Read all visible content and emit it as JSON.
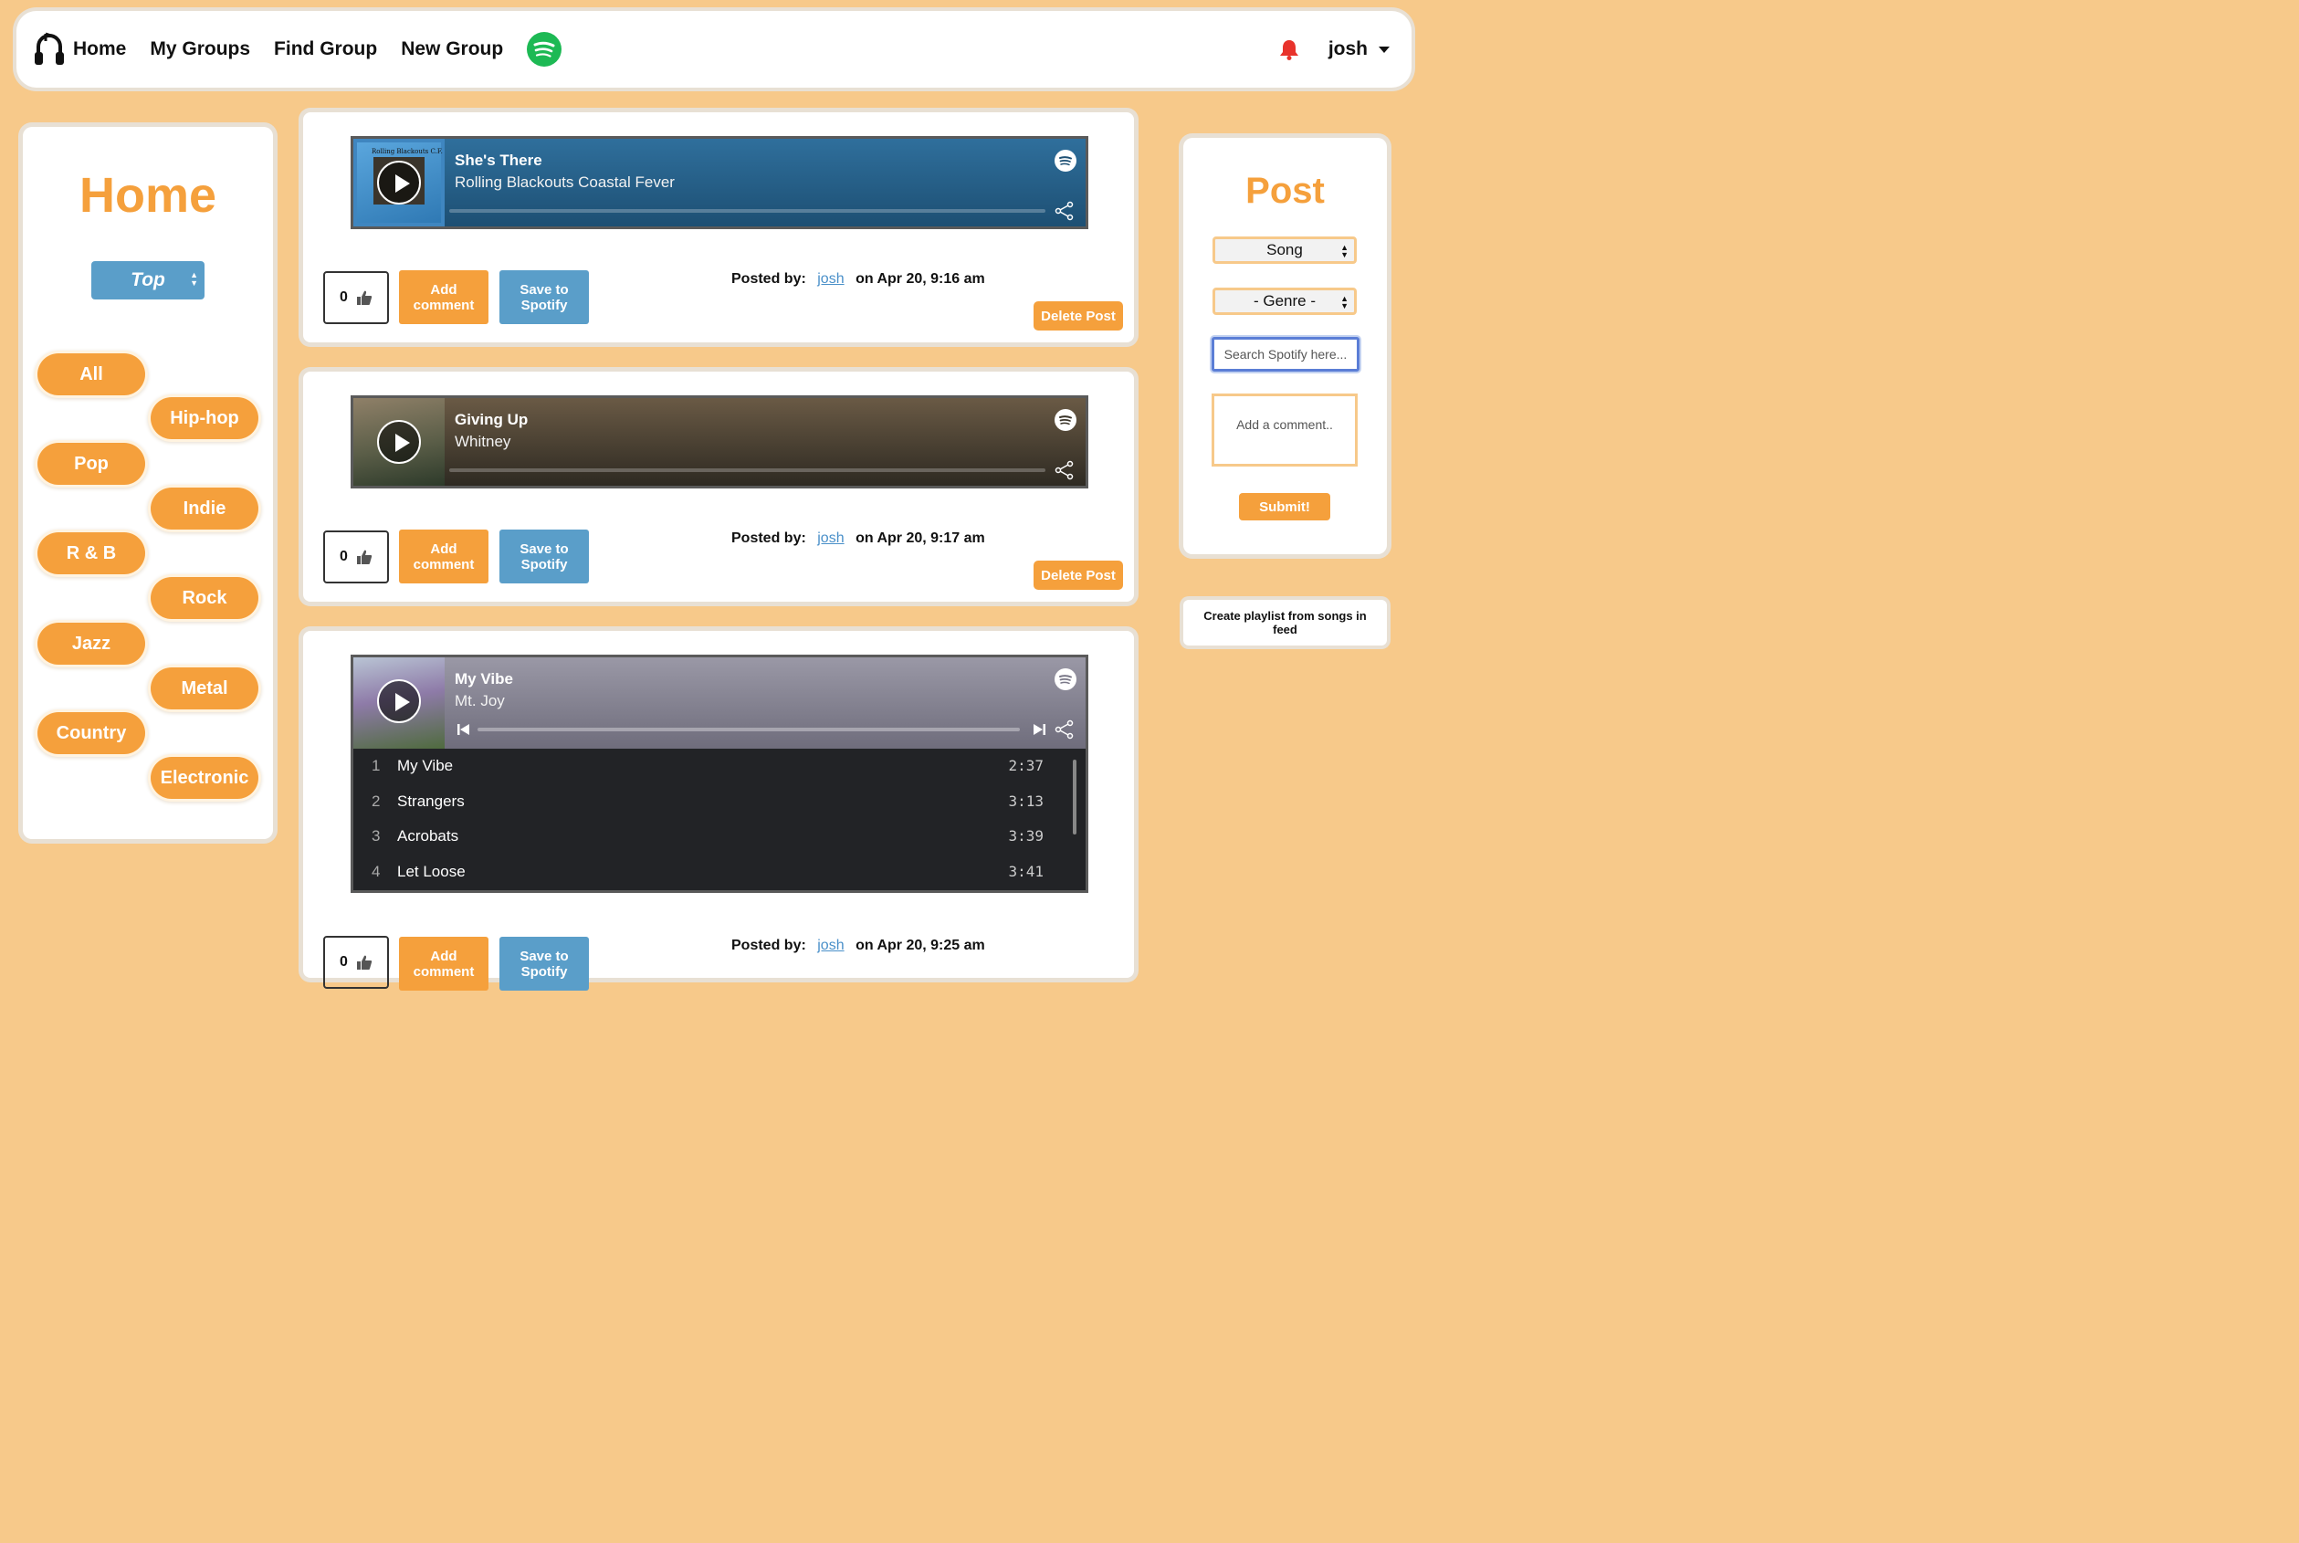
{
  "nav": {
    "home": "Home",
    "my_groups": "My Groups",
    "find_group": "Find Group",
    "new_group": "New Group",
    "user": "josh",
    "icons": [
      "headphones-logo-icon",
      "spotify-icon",
      "bell-icon",
      "caret-down-icon"
    ]
  },
  "left": {
    "title": "Home",
    "sort": "Top",
    "genres": [
      "All",
      "Hip-hop",
      "Pop",
      "Indie",
      "R & B",
      "Rock",
      "Jazz",
      "Metal",
      "Country",
      "Electronic"
    ]
  },
  "posts": [
    {
      "track": "She's There",
      "artist": "Rolling Blackouts Coastal Fever",
      "likes": "0",
      "add_comment": "Add comment",
      "save": "Save to Spotify",
      "posted_label": "Posted by:",
      "user": "josh",
      "date": "on Apr 20, 9:16 am",
      "delete": "Delete Post",
      "art_text": "Rolling Blackouts C.F."
    },
    {
      "track": "Giving Up",
      "artist": "Whitney",
      "likes": "0",
      "add_comment": "Add comment",
      "save": "Save to Spotify",
      "posted_label": "Posted by:",
      "user": "josh",
      "date": "on Apr 20, 9:17 am",
      "delete": "Delete Post"
    },
    {
      "track": "My Vibe",
      "artist": "Mt. Joy",
      "likes": "0",
      "add_comment": "Add comment",
      "save": "Save to Spotify",
      "posted_label": "Posted by:",
      "user": "josh",
      "date": "on Apr 20, 9:25 am",
      "tracks": [
        {
          "num": "1",
          "name": "My Vibe",
          "dur": "2:37"
        },
        {
          "num": "2",
          "name": "Strangers",
          "dur": "3:13"
        },
        {
          "num": "3",
          "name": "Acrobats",
          "dur": "3:39"
        },
        {
          "num": "4",
          "name": "Let Loose",
          "dur": "3:41"
        }
      ]
    }
  ],
  "right": {
    "title": "Post",
    "type_select": "Song",
    "genre_select": "- Genre -",
    "search_placeholder": "Search Spotify here...",
    "comment_placeholder": "Add a comment..",
    "submit": "Submit!",
    "playlist_button": "Create playlist from songs in feed"
  },
  "colors": {
    "background": "#f7c98a",
    "accent_orange": "#f5a03c",
    "accent_blue": "#5a9ec9",
    "bell": "#e8332c",
    "spotify_green": "#1db954"
  }
}
